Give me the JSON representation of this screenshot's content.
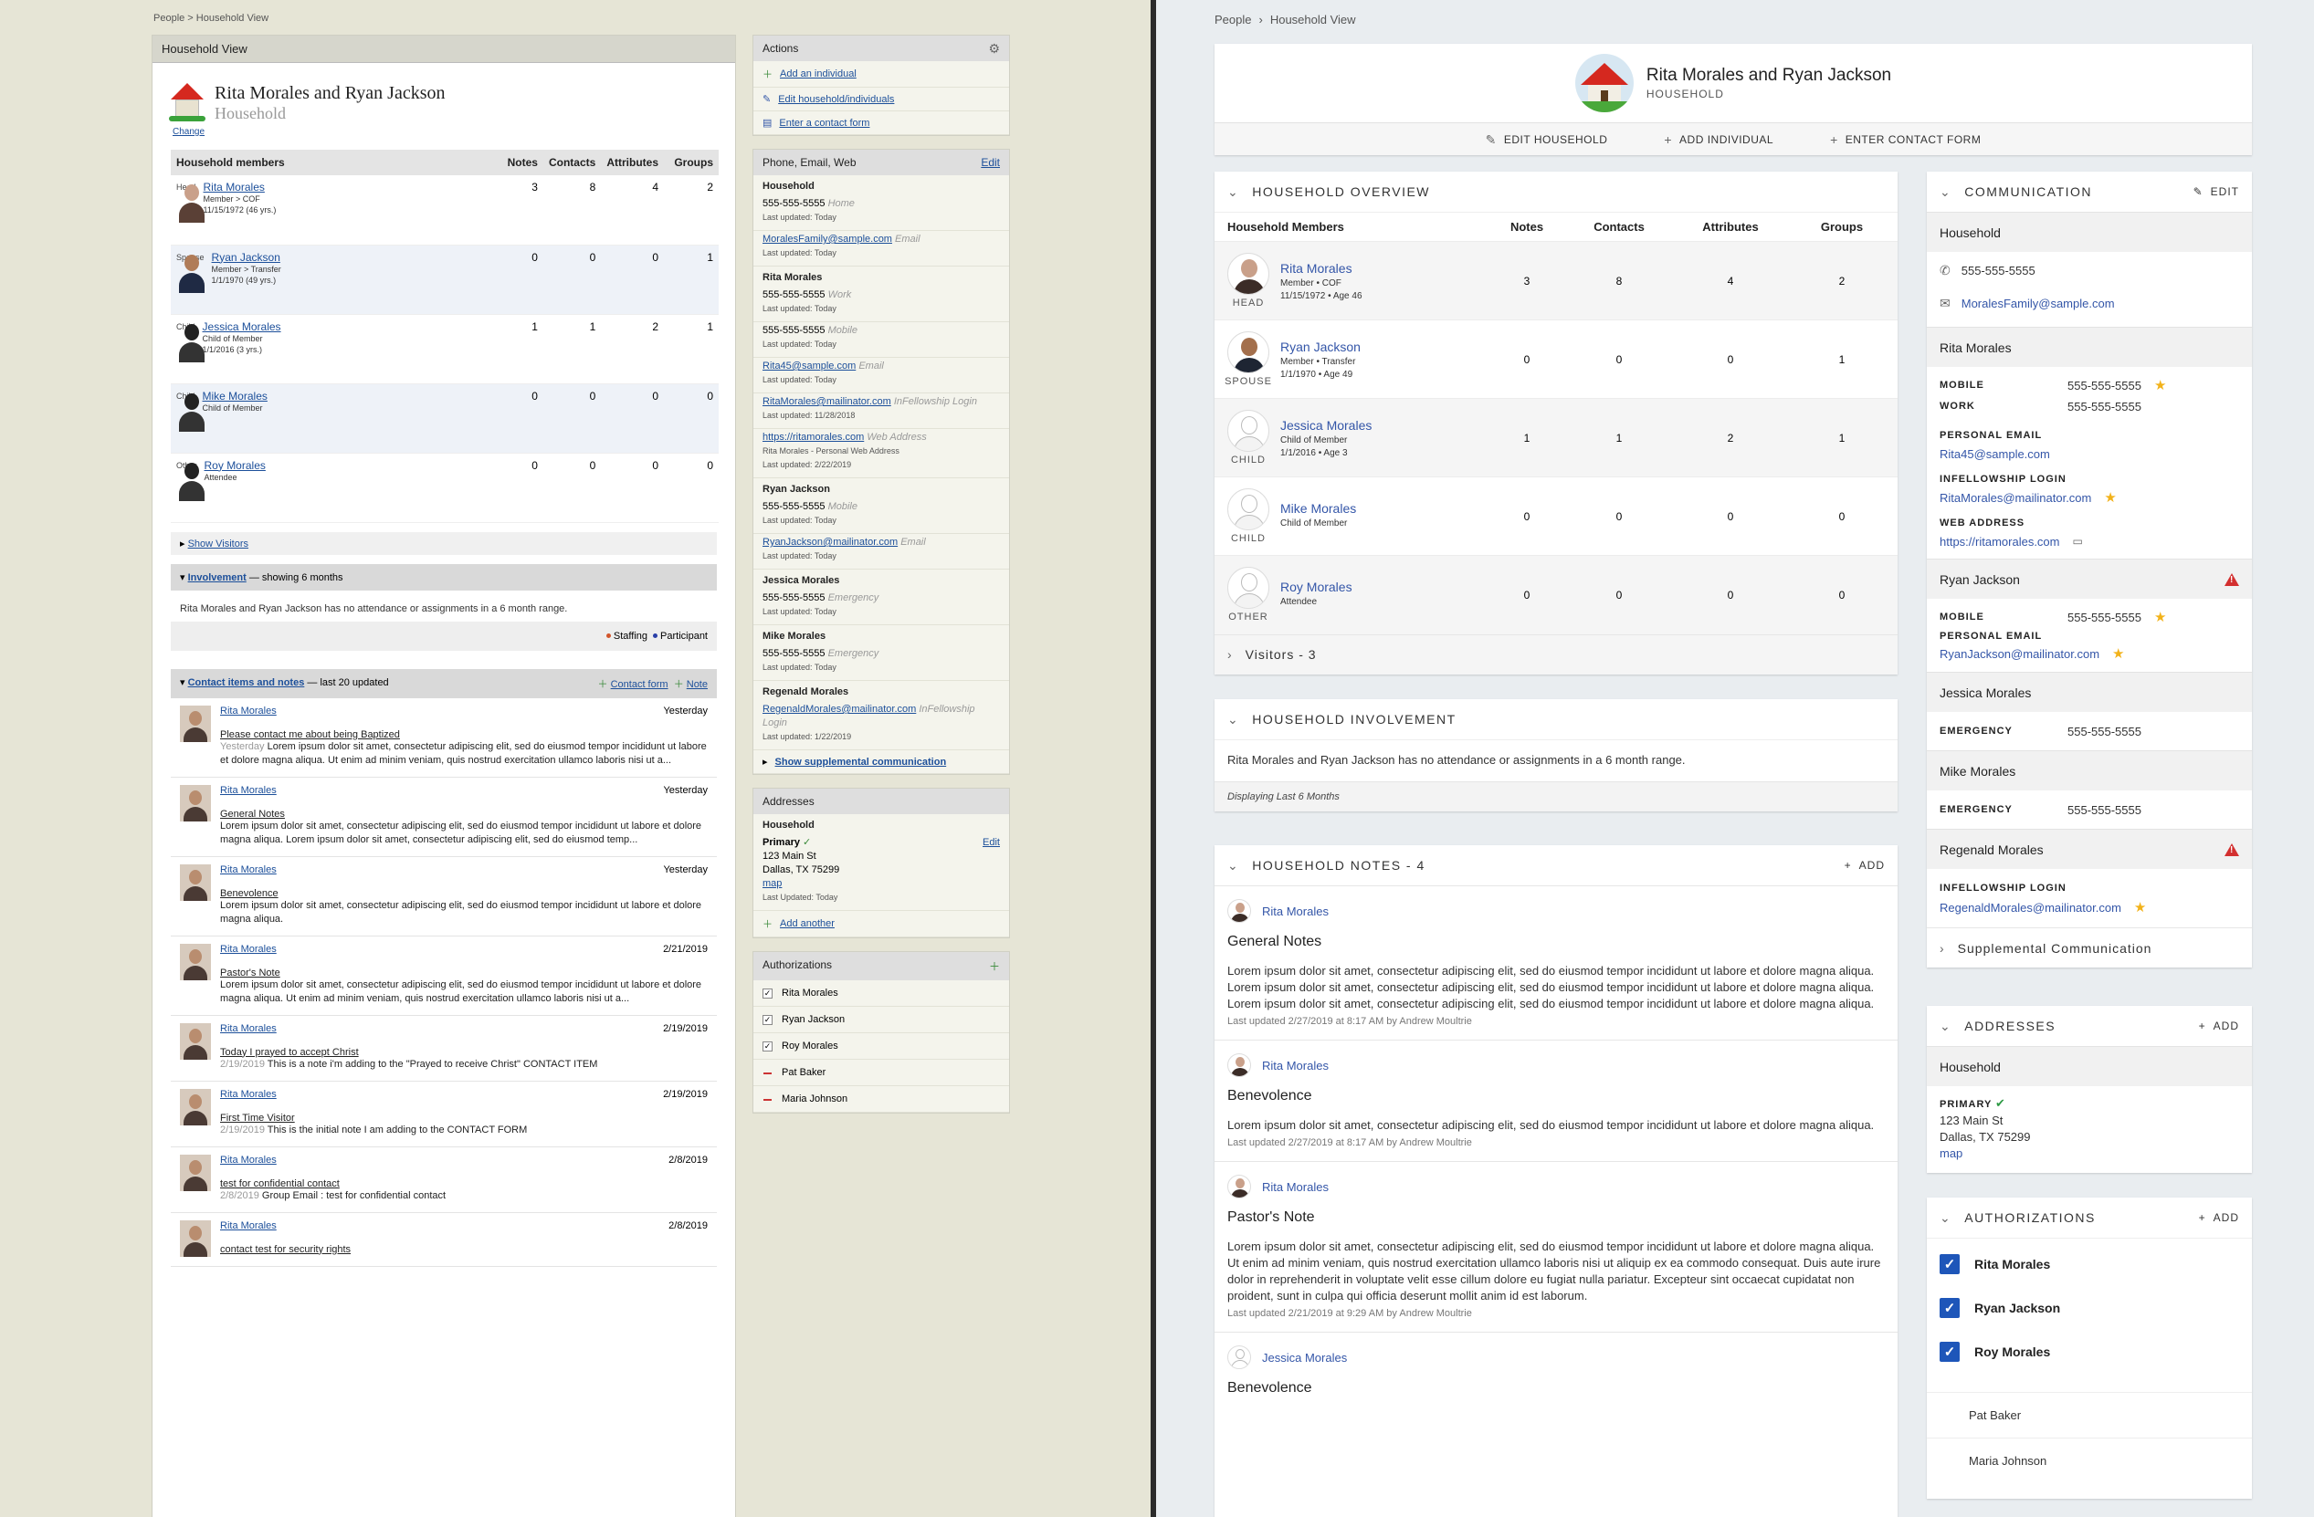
{
  "old": {
    "breadcrumb": "People > Household View",
    "panel_title": "Household View",
    "household_name": "Rita Morales and Ryan Jackson",
    "household_sub": "Household",
    "change_link": "Change",
    "members_header": [
      "Household members",
      "Notes",
      "Contacts",
      "Attributes",
      "Groups"
    ],
    "members": [
      {
        "name": "Rita Morales",
        "line1": "Member > COF",
        "line2": "11/15/1972 (46 yrs.)",
        "role": "Head",
        "notes": "3",
        "contacts": "8",
        "attributes": "4",
        "groups": "2"
      },
      {
        "name": "Ryan Jackson",
        "line1": "Member > Transfer",
        "line2": "1/1/1970 (49 yrs.)",
        "role": "Spouse",
        "notes": "0",
        "contacts": "0",
        "attributes": "0",
        "groups": "1"
      },
      {
        "name": "Jessica Morales",
        "line1": "Child of Member",
        "line2": "1/1/2016 (3 yrs.)",
        "role": "Child",
        "notes": "1",
        "contacts": "1",
        "attributes": "2",
        "groups": "1"
      },
      {
        "name": "Mike Morales",
        "line1": "Child of Member",
        "line2": "",
        "role": "Child",
        "notes": "0",
        "contacts": "0",
        "attributes": "0",
        "groups": "0"
      },
      {
        "name": "Roy Morales",
        "line1": "Attendee",
        "line2": "",
        "role": "Other",
        "notes": "0",
        "contacts": "0",
        "attributes": "0",
        "groups": "0"
      }
    ],
    "show_visitors": "Show Visitors",
    "involvement_title": "Involvement",
    "involvement_suffix": "— showing 6 months",
    "involvement_text": "Rita Morales and Ryan Jackson has no attendance or assignments in a 6 month range.",
    "legend_staffing": "Staffing",
    "legend_participant": "Participant",
    "contact_title": "Contact items and notes",
    "contact_suffix": "— last 20 updated",
    "contact_form_link": "Contact form",
    "note_link": "Note",
    "notes": [
      {
        "user": "Rita Morales",
        "date": "Yesterday",
        "title": "Please contact me about being Baptized",
        "prefix": "Yesterday",
        "text": "Lorem ipsum dolor sit amet, consectetur adipiscing elit, sed do eiusmod tempor incididunt ut labore et dolore magna aliqua. Ut enim ad minim veniam, quis nostrud exercitation ullamco laboris nisi ut a..."
      },
      {
        "user": "Rita Morales",
        "date": "Yesterday",
        "title": "General Notes",
        "prefix": "",
        "text": "Lorem ipsum dolor sit amet, consectetur adipiscing elit, sed do eiusmod tempor incididunt ut labore et dolore magna aliqua. Lorem ipsum dolor sit amet, consectetur adipiscing elit, sed do eiusmod temp..."
      },
      {
        "user": "Rita Morales",
        "date": "Yesterday",
        "title": "Benevolence",
        "prefix": "",
        "text": "Lorem ipsum dolor sit amet, consectetur adipiscing elit, sed do eiusmod tempor incididunt ut labore et dolore magna aliqua."
      },
      {
        "user": "Rita Morales",
        "date": "2/21/2019",
        "title": "Pastor's Note",
        "prefix": "",
        "text": "Lorem ipsum dolor sit amet, consectetur adipiscing elit, sed do eiusmod tempor incididunt ut labore et dolore magna aliqua. Ut enim ad minim veniam, quis nostrud exercitation ullamco laboris nisi ut a..."
      },
      {
        "user": "Rita Morales",
        "date": "2/19/2019",
        "title": "Today I prayed to accept Christ",
        "prefix": "2/19/2019",
        "text": "This is a note i'm adding to the \"Prayed to receive Christ\" CONTACT ITEM"
      },
      {
        "user": "Rita Morales",
        "date": "2/19/2019",
        "title": "First Time Visitor",
        "prefix": "2/19/2019",
        "text": "This is the initial note I am adding to the CONTACT FORM"
      },
      {
        "user": "Rita Morales",
        "date": "2/8/2019",
        "title": "test for confidential contact",
        "prefix": "2/8/2019",
        "text": "Group Email : test for confidential contact"
      },
      {
        "user": "Rita Morales",
        "date": "2/8/2019",
        "title": "contact test for security rights",
        "prefix": "",
        "text": ""
      }
    ],
    "actions_title": "Actions",
    "actions": [
      "Add an individual",
      "Edit household/individuals",
      "Enter a contact form"
    ],
    "pew_title": "Phone, Email, Web",
    "edit": "Edit",
    "pew_groups": [
      {
        "name": "Household",
        "items": [
          {
            "val": "555-555-5555",
            "type": "Home",
            "link": false,
            "upd": "Last updated: Today"
          },
          {
            "val": "MoralesFamily@sample.com",
            "type": "Email",
            "link": true,
            "upd": "Last updated: Today"
          }
        ]
      },
      {
        "name": "Rita Morales",
        "items": [
          {
            "val": "555-555-5555",
            "type": "Work",
            "link": false,
            "upd": "Last updated: Today"
          },
          {
            "val": "555-555-5555",
            "type": "Mobile",
            "link": false,
            "upd": "Last updated: Today"
          },
          {
            "val": "Rita45@sample.com",
            "type": "Email",
            "link": true,
            "upd": "Last updated: Today"
          },
          {
            "val": "RitaMorales@mailinator.com",
            "type": "InFellowship Login",
            "link": true,
            "upd": "Last updated: 11/28/2018"
          },
          {
            "val": "https://ritamorales.com",
            "type": "Web Address",
            "link": true,
            "extra": "Rita Morales - Personal Web Address",
            "upd": "Last updated: 2/22/2019"
          }
        ]
      },
      {
        "name": "Ryan Jackson",
        "items": [
          {
            "val": "555-555-5555",
            "type": "Mobile",
            "link": false,
            "upd": "Last updated: Today"
          },
          {
            "val": "RyanJackson@mailinator.com",
            "type": "Email",
            "link": true,
            "upd": "Last updated: Today"
          }
        ]
      },
      {
        "name": "Jessica Morales",
        "items": [
          {
            "val": "555-555-5555",
            "type": "Emergency",
            "link": false,
            "upd": "Last updated: Today"
          }
        ]
      },
      {
        "name": "Mike Morales",
        "items": [
          {
            "val": "555-555-5555",
            "type": "Emergency",
            "link": false,
            "upd": "Last updated: Today"
          }
        ]
      },
      {
        "name": "Regenald Morales",
        "items": [
          {
            "val": "RegenaldMorales@mailinator.com",
            "type": "InFellowship Login",
            "link": true,
            "upd": "Last updated: 1/22/2019"
          }
        ]
      }
    ],
    "show_supplemental": "Show supplemental communication",
    "addresses_title": "Addresses",
    "addr_group": "Household",
    "addr_primary": "Primary",
    "addr_line1": "123 Main St",
    "addr_line2": "Dallas, TX 75299",
    "addr_map": "map",
    "addr_updated": "Last Updated: Today",
    "add_another": "Add another",
    "auth_title": "Authorizations",
    "auths": [
      {
        "name": "Rita Morales",
        "checked": true
      },
      {
        "name": "Ryan Jackson",
        "checked": true
      },
      {
        "name": "Roy Morales",
        "checked": true
      },
      {
        "name": "Pat Baker",
        "checked": false
      },
      {
        "name": "Maria Johnson",
        "checked": false
      }
    ]
  },
  "new": {
    "breadcrumb": [
      "People",
      "Household View"
    ],
    "household_name": "Rita Morales and Ryan Jackson",
    "household_sub": "HOUSEHOLD",
    "edit_household": "EDIT HOUSEHOLD",
    "add_individual": "ADD INDIVIDUAL",
    "enter_contact": "ENTER CONTACT FORM",
    "overview_title": "HOUSEHOLD OVERVIEW",
    "members_header": [
      "Household Members",
      "Notes",
      "Contacts",
      "Attributes",
      "Groups"
    ],
    "members": [
      {
        "name": "Rita Morales",
        "line1": "Member • COF",
        "line2": "11/15/1972 • Age 46",
        "role": "HEAD",
        "notes": "3",
        "contacts": "8",
        "attributes": "4",
        "groups": "2"
      },
      {
        "name": "Ryan Jackson",
        "line1": "Member • Transfer",
        "line2": "1/1/1970 • Age 49",
        "role": "SPOUSE",
        "notes": "0",
        "contacts": "0",
        "attributes": "0",
        "groups": "1"
      },
      {
        "name": "Jessica Morales",
        "line1": "Child of Member",
        "line2": "1/1/2016 • Age 3",
        "role": "CHILD",
        "notes": "1",
        "contacts": "1",
        "attributes": "2",
        "groups": "1"
      },
      {
        "name": "Mike Morales",
        "line1": "Child of Member",
        "line2": "",
        "role": "CHILD",
        "notes": "0",
        "contacts": "0",
        "attributes": "0",
        "groups": "0"
      },
      {
        "name": "Roy Morales",
        "line1": "Attendee",
        "line2": "",
        "role": "OTHER",
        "notes": "0",
        "contacts": "0",
        "attributes": "0",
        "groups": "0"
      }
    ],
    "visitors": "Visitors - 3",
    "involvement_title": "HOUSEHOLD INVOLVEMENT",
    "involvement_text": "Rita Morales and Ryan Jackson has no attendance or assignments in a 6 month range.",
    "involvement_foot": "Displaying Last 6 Months",
    "notes_title": "HOUSEHOLD NOTES - 4",
    "add": "ADD",
    "edit": "EDIT",
    "notes": [
      {
        "user": "Rita Morales",
        "title": "General Notes",
        "text": "Lorem ipsum dolor sit amet, consectetur adipiscing elit, sed do eiusmod tempor incididunt ut labore et dolore magna aliqua. Lorem ipsum dolor sit amet, consectetur adipiscing elit, sed do eiusmod tempor incididunt ut labore et dolore magna aliqua. Lorem ipsum dolor sit amet, consectetur adipiscing elit, sed do eiusmod tempor incididunt ut labore et dolore magna aliqua.",
        "upd": "Last updated 2/27/2019 at 8:17 AM by Andrew Moultrie"
      },
      {
        "user": "Rita Morales",
        "title": "Benevolence",
        "text": "Lorem ipsum dolor sit amet, consectetur adipiscing elit, sed do eiusmod tempor incididunt ut labore et dolore magna aliqua.",
        "upd": "Last updated 2/27/2019 at 8:17 AM by Andrew Moultrie"
      },
      {
        "user": "Rita Morales",
        "title": "Pastor's Note",
        "text": "Lorem ipsum dolor sit amet, consectetur adipiscing elit, sed do eiusmod tempor incididunt ut labore et dolore magna aliqua. Ut enim ad minim veniam, quis nostrud exercitation ullamco laboris nisi ut aliquip ex ea commodo consequat. Duis aute irure dolor in reprehenderit in voluptate velit esse cillum dolore eu fugiat nulla pariatur. Excepteur sint occaecat cupidatat non proident, sunt in culpa qui officia deserunt mollit anim id est laborum.",
        "upd": "Last updated 2/21/2019 at 9:29 AM by Andrew Moultrie"
      },
      {
        "user": "Jessica Morales",
        "title": "Benevolence",
        "text": "",
        "upd": ""
      }
    ],
    "comm_title": "COMMUNICATION",
    "comm_household": "Household",
    "comm_phone": "555-555-5555",
    "comm_email": "MoralesFamily@sample.com",
    "rita": "Rita Morales",
    "mobile": "MOBILE",
    "work": "WORK",
    "personal_email": "PERSONAL EMAIL",
    "infellowship": "INFELLOWSHIP LOGIN",
    "web_address": "WEB ADDRESS",
    "emergency": "EMERGENCY",
    "phone": "555-555-5555",
    "rita_email": "Rita45@sample.com",
    "rita_login": "RitaMorales@mailinator.com",
    "rita_web": "https://ritamorales.com",
    "ryan": "Ryan Jackson",
    "ryan_email": "RyanJackson@mailinator.com",
    "jessica": "Jessica Morales",
    "mike": "Mike Morales",
    "regenald": "Regenald Morales",
    "regenald_login": "RegenaldMorales@mailinator.com",
    "supplemental": "Supplemental Communication",
    "addresses_title": "ADDRESSES",
    "addr_group": "Household",
    "addr_primary": "PRIMARY",
    "addr_line1": "123 Main St",
    "addr_line2": "Dallas, TX 75299",
    "addr_map": "map",
    "auth_title": "AUTHORIZATIONS",
    "auths_checked": [
      "Rita Morales",
      "Ryan Jackson",
      "Roy Morales"
    ],
    "auths_unchecked": [
      "Pat Baker",
      "Maria Johnson"
    ]
  },
  "colors": {
    "accent": "#3456a8",
    "check": "#1e56b9",
    "warn": "#d32f2f",
    "star": "#f2b21a",
    "old_link": "#1c4f9a"
  }
}
